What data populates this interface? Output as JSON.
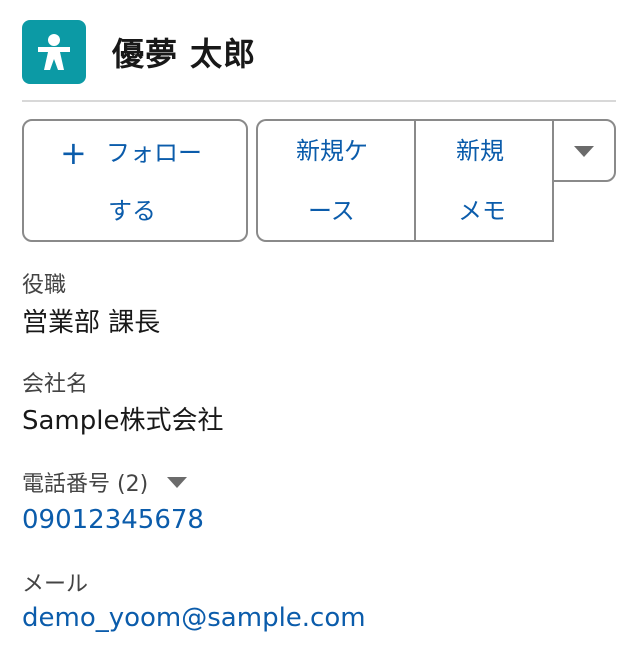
{
  "record": {
    "icon": "person-icon",
    "icon_color": "#0c9aa5",
    "name": "優夢 太郎"
  },
  "actions": {
    "follow_plus": "+",
    "follow_line1": "フォロー",
    "follow_line2": "する",
    "new_case_line1": "新規ケ",
    "new_case_line2": "ース",
    "new_memo_line1": "新規",
    "new_memo_line2": "メモ",
    "more_icon": "caret-down-icon"
  },
  "fields": {
    "title_label": "役職",
    "title_value": "営業部 課長",
    "company_label": "会社名",
    "company_value": "Sample株式会社",
    "phone_label": "電話番号 (2)",
    "phone_value": "09012345678",
    "email_label": "メール",
    "email_value": "demo_yoom@sample.com"
  },
  "colors": {
    "link": "#0b5cab",
    "accent": "#0c9aa5"
  }
}
